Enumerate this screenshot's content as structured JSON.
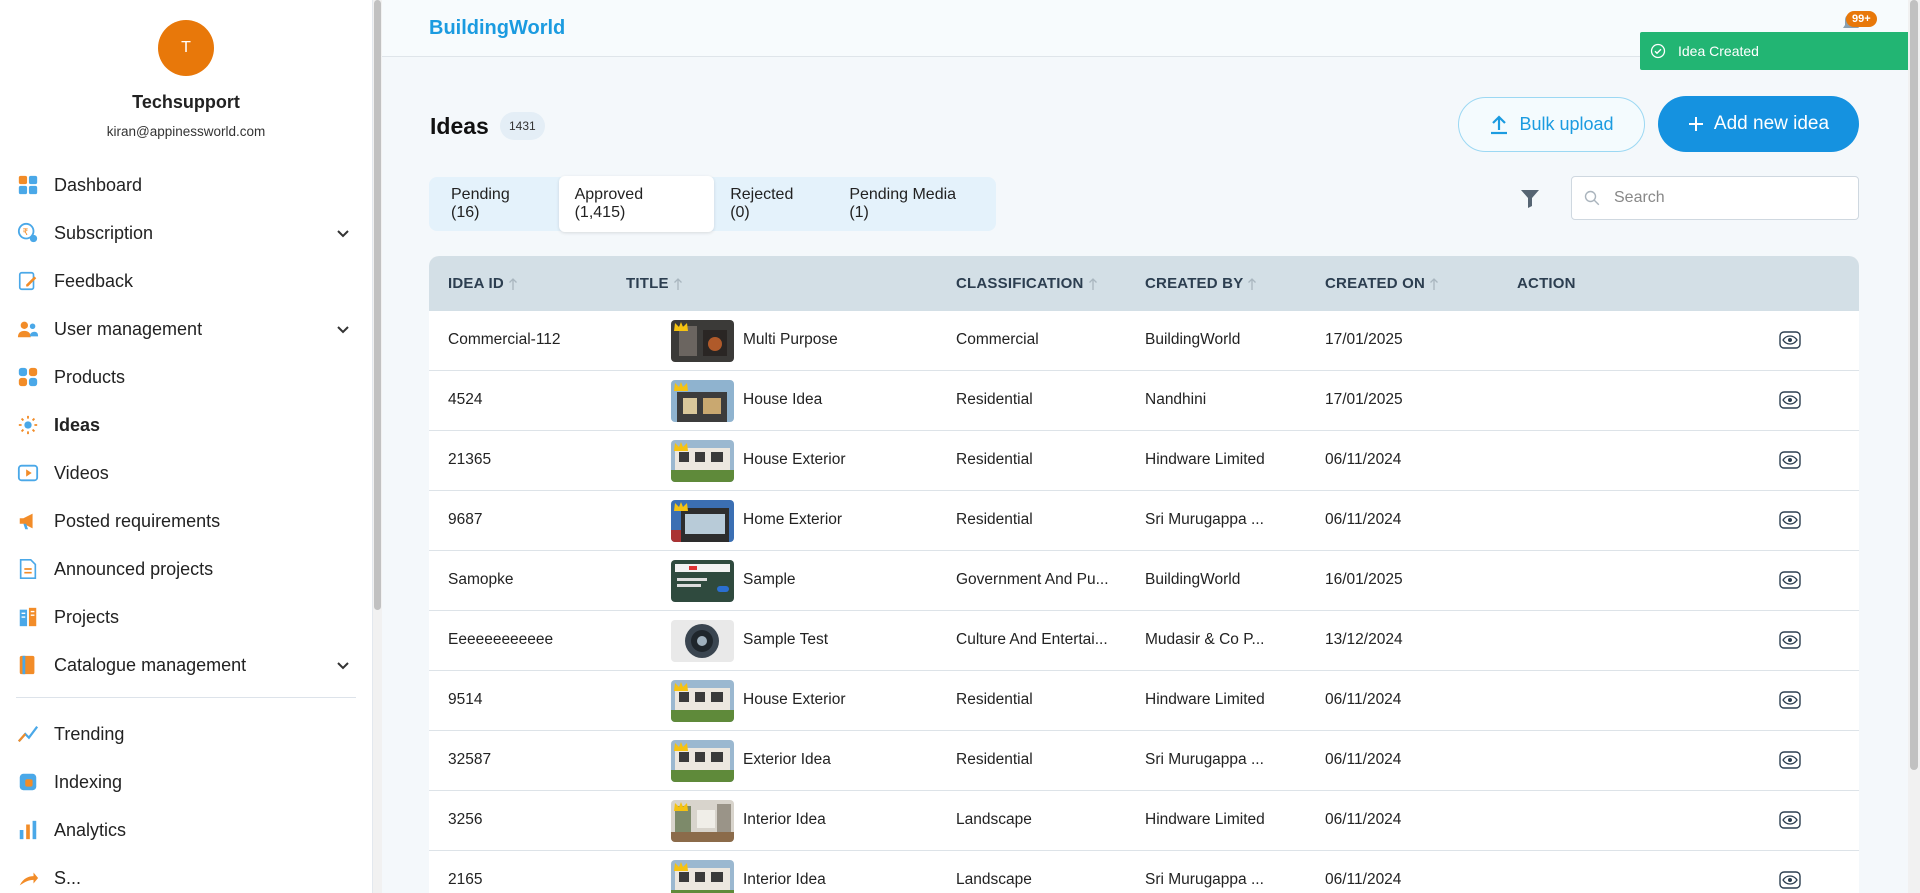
{
  "profile": {
    "initial": "T",
    "name": "Techsupport",
    "email": "kiran@appinessworld.com"
  },
  "nav": [
    {
      "label": "Dashboard",
      "icon": "dashboard-icon",
      "chevron": false
    },
    {
      "label": "Subscription",
      "icon": "subscription-icon",
      "chevron": true
    },
    {
      "label": "Feedback",
      "icon": "feedback-icon",
      "chevron": false
    },
    {
      "label": "User management",
      "icon": "users-icon",
      "chevron": true
    },
    {
      "label": "Products",
      "icon": "products-icon",
      "chevron": false
    },
    {
      "label": "Ideas",
      "icon": "bulb-icon",
      "chevron": false,
      "active": true
    },
    {
      "label": "Videos",
      "icon": "video-icon",
      "chevron": false
    },
    {
      "label": "Posted requirements",
      "icon": "megaphone-icon",
      "chevron": false
    },
    {
      "label": "Announced projects",
      "icon": "document-icon",
      "chevron": false
    },
    {
      "label": "Projects",
      "icon": "building-icon",
      "chevron": false
    },
    {
      "label": "Catalogue management",
      "icon": "catalogue-icon",
      "chevron": true
    },
    {
      "label": "Trending",
      "icon": "trending-icon",
      "chevron": false
    },
    {
      "label": "Indexing",
      "icon": "indexing-icon",
      "chevron": false
    },
    {
      "label": "Analytics",
      "icon": "analytics-icon",
      "chevron": false
    },
    {
      "label": "S...",
      "icon": "share-icon",
      "chevron": false
    }
  ],
  "topbar": {
    "brand": "BuildingWorld",
    "notif_count": "99+"
  },
  "toast": {
    "message": "Idea Created"
  },
  "page": {
    "title": "Ideas",
    "count": "1431"
  },
  "actions": {
    "bulk_upload": "Bulk upload",
    "add_new": "Add new idea"
  },
  "tabs": [
    {
      "label": "Pending (16)",
      "active": false
    },
    {
      "label": "Approved (1,415)",
      "active": true
    },
    {
      "label": "Rejected (0)",
      "active": false
    },
    {
      "label": "Pending Media (1)",
      "active": false
    }
  ],
  "search": {
    "placeholder": "Search",
    "value": ""
  },
  "table": {
    "columns": [
      "IDEA ID",
      "TITLE",
      "CLASSIFICATION",
      "CREATED BY",
      "CREATED ON",
      "ACTION"
    ],
    "rows": [
      {
        "id": "Commercial-112",
        "title": "Multi Purpose",
        "classification": "Commercial",
        "created_by": "BuildingWorld",
        "created_on": "17/01/2025",
        "thumb": "thumb-interior-dark",
        "crown": true
      },
      {
        "id": "4524",
        "title": "House Idea",
        "classification": "Residential",
        "created_by": "Nandhini",
        "created_on": "17/01/2025",
        "thumb": "thumb-house-modern",
        "crown": true
      },
      {
        "id": "21365",
        "title": "House Exterior",
        "classification": "Residential",
        "created_by": "Hindware Limited",
        "created_on": "06/11/2024",
        "thumb": "thumb-house-garden",
        "crown": true
      },
      {
        "id": "9687",
        "title": "Home Exterior",
        "classification": "Residential",
        "created_by": "Sri Murugappa ...",
        "created_on": "06/11/2024",
        "thumb": "thumb-house-blue",
        "crown": true
      },
      {
        "id": "Samopke",
        "title": "Sample",
        "classification": "Government And Pu...",
        "created_by": "BuildingWorld",
        "created_on": "16/01/2025",
        "thumb": "thumb-screenshot",
        "crown": false
      },
      {
        "id": "Eeeeeeeeeeee",
        "title": "Sample Test",
        "classification": "Culture And Entertai...",
        "created_by": "Mudasir & Co P...",
        "created_on": "13/12/2024",
        "thumb": "thumb-round",
        "crown": false
      },
      {
        "id": "9514",
        "title": "House Exterior",
        "classification": "Residential",
        "created_by": "Hindware Limited",
        "created_on": "06/11/2024",
        "thumb": "thumb-house-garden",
        "crown": true
      },
      {
        "id": "32587",
        "title": "Exterior Idea",
        "classification": "Residential",
        "created_by": "Sri Murugappa ...",
        "created_on": "06/11/2024",
        "thumb": "thumb-house-garden",
        "crown": true
      },
      {
        "id": "3256",
        "title": "Interior Idea",
        "classification": "Landscape",
        "created_by": "Hindware Limited",
        "created_on": "06/11/2024",
        "thumb": "thumb-interior-light",
        "crown": true
      },
      {
        "id": "2165",
        "title": "Interior Idea",
        "classification": "Landscape",
        "created_by": "Sri Murugappa ...",
        "created_on": "06/11/2024",
        "thumb": "thumb-house-garden",
        "crown": true
      }
    ]
  },
  "colors": {
    "accent": "#1592e0",
    "brand": "#1b9be0",
    "avatar": "#e8780a",
    "toast": "#22b573",
    "header_bg": "#d3dfe6"
  }
}
